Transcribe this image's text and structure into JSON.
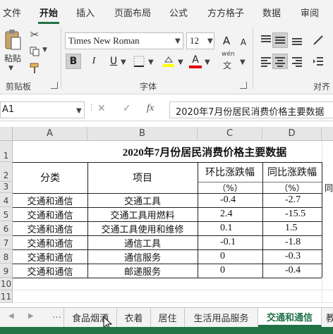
{
  "menu": {
    "items": [
      "文件",
      "开始",
      "插入",
      "页面布局",
      "公式",
      "方方格子",
      "数据",
      "审阅"
    ],
    "active_index": 1
  },
  "ribbon": {
    "clipboard": {
      "paste_label": "粘贴",
      "group_label": "剪贴板"
    },
    "font": {
      "font_name": "Times New Roman",
      "font_size": "12",
      "grow_label": "A",
      "shrink_label": "A",
      "bold": "B",
      "italic": "I",
      "underline": "U",
      "font_color_glyph": "A",
      "phonetic_top": "wén",
      "phonetic_bottom": "文",
      "group_label": "字体",
      "highlight_color": "#ffff00",
      "font_color": "#e00000"
    },
    "alignment": {
      "group_label": "对齐"
    }
  },
  "formula_bar": {
    "name_box": "A1",
    "fx_label": "fx",
    "content": "2020年7月份居民消费价格主要数据"
  },
  "sheet": {
    "columns": [
      "A",
      "B",
      "C",
      "D"
    ],
    "rows": [
      "1",
      "2",
      "3",
      "4",
      "5",
      "6",
      "7",
      "8",
      "9",
      "10",
      "11"
    ],
    "title": "2020年7月份居民消费价格主要数据",
    "headers": {
      "category": "分类",
      "item": "项目",
      "mom": "环比涨跌幅",
      "yoy": "同比涨跌幅",
      "unit_c": "（%）",
      "unit_d": "（%）",
      "partial_e": "同"
    },
    "data": [
      {
        "category": "交通和通信",
        "item": "交通工具",
        "mom": "-0.4",
        "yoy": "-2.7"
      },
      {
        "category": "交通和通信",
        "item": "交通工具用燃料",
        "mom": "2.4",
        "yoy": "-15.5"
      },
      {
        "category": "交通和通信",
        "item": "交通工具使用和维修",
        "mom": "0.1",
        "yoy": "1.5"
      },
      {
        "category": "交通和通信",
        "item": "通信工具",
        "mom": "-0.1",
        "yoy": "-1.8"
      },
      {
        "category": "交通和通信",
        "item": "通信服务",
        "mom": "0",
        "yoy": "-0.3"
      },
      {
        "category": "交通和通信",
        "item": "邮递服务",
        "mom": "0",
        "yoy": "-0.4"
      }
    ]
  },
  "tabs": {
    "items": [
      "食品烟酒",
      "衣着",
      "居住",
      "生活用品服务",
      "交通和通信",
      "教"
    ],
    "active_index": 4
  },
  "colors": {
    "accent": "#217346"
  }
}
